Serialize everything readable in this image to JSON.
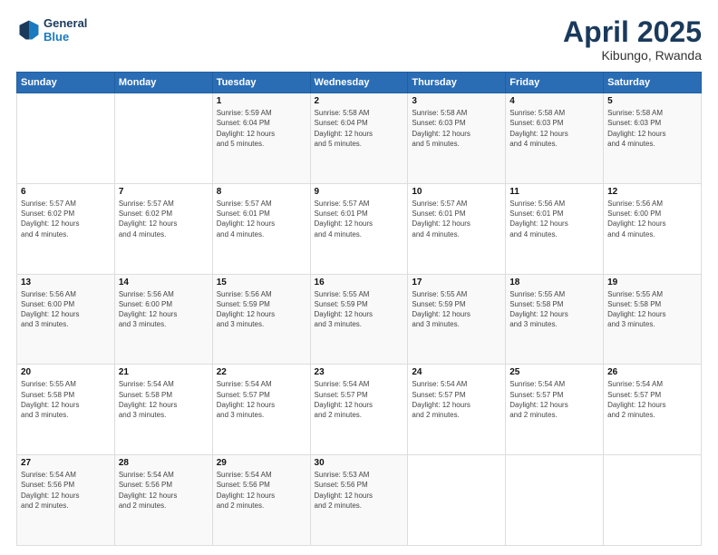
{
  "header": {
    "logo_line1": "General",
    "logo_line2": "Blue",
    "title": "April 2025",
    "location": "Kibungo, Rwanda"
  },
  "days_of_week": [
    "Sunday",
    "Monday",
    "Tuesday",
    "Wednesday",
    "Thursday",
    "Friday",
    "Saturday"
  ],
  "weeks": [
    [
      {
        "day": "",
        "info": ""
      },
      {
        "day": "",
        "info": ""
      },
      {
        "day": "1",
        "info": "Sunrise: 5:59 AM\nSunset: 6:04 PM\nDaylight: 12 hours\nand 5 minutes."
      },
      {
        "day": "2",
        "info": "Sunrise: 5:58 AM\nSunset: 6:04 PM\nDaylight: 12 hours\nand 5 minutes."
      },
      {
        "day": "3",
        "info": "Sunrise: 5:58 AM\nSunset: 6:03 PM\nDaylight: 12 hours\nand 5 minutes."
      },
      {
        "day": "4",
        "info": "Sunrise: 5:58 AM\nSunset: 6:03 PM\nDaylight: 12 hours\nand 4 minutes."
      },
      {
        "day": "5",
        "info": "Sunrise: 5:58 AM\nSunset: 6:03 PM\nDaylight: 12 hours\nand 4 minutes."
      }
    ],
    [
      {
        "day": "6",
        "info": "Sunrise: 5:57 AM\nSunset: 6:02 PM\nDaylight: 12 hours\nand 4 minutes."
      },
      {
        "day": "7",
        "info": "Sunrise: 5:57 AM\nSunset: 6:02 PM\nDaylight: 12 hours\nand 4 minutes."
      },
      {
        "day": "8",
        "info": "Sunrise: 5:57 AM\nSunset: 6:01 PM\nDaylight: 12 hours\nand 4 minutes."
      },
      {
        "day": "9",
        "info": "Sunrise: 5:57 AM\nSunset: 6:01 PM\nDaylight: 12 hours\nand 4 minutes."
      },
      {
        "day": "10",
        "info": "Sunrise: 5:57 AM\nSunset: 6:01 PM\nDaylight: 12 hours\nand 4 minutes."
      },
      {
        "day": "11",
        "info": "Sunrise: 5:56 AM\nSunset: 6:01 PM\nDaylight: 12 hours\nand 4 minutes."
      },
      {
        "day": "12",
        "info": "Sunrise: 5:56 AM\nSunset: 6:00 PM\nDaylight: 12 hours\nand 4 minutes."
      }
    ],
    [
      {
        "day": "13",
        "info": "Sunrise: 5:56 AM\nSunset: 6:00 PM\nDaylight: 12 hours\nand 3 minutes."
      },
      {
        "day": "14",
        "info": "Sunrise: 5:56 AM\nSunset: 6:00 PM\nDaylight: 12 hours\nand 3 minutes."
      },
      {
        "day": "15",
        "info": "Sunrise: 5:56 AM\nSunset: 5:59 PM\nDaylight: 12 hours\nand 3 minutes."
      },
      {
        "day": "16",
        "info": "Sunrise: 5:55 AM\nSunset: 5:59 PM\nDaylight: 12 hours\nand 3 minutes."
      },
      {
        "day": "17",
        "info": "Sunrise: 5:55 AM\nSunset: 5:59 PM\nDaylight: 12 hours\nand 3 minutes."
      },
      {
        "day": "18",
        "info": "Sunrise: 5:55 AM\nSunset: 5:58 PM\nDaylight: 12 hours\nand 3 minutes."
      },
      {
        "day": "19",
        "info": "Sunrise: 5:55 AM\nSunset: 5:58 PM\nDaylight: 12 hours\nand 3 minutes."
      }
    ],
    [
      {
        "day": "20",
        "info": "Sunrise: 5:55 AM\nSunset: 5:58 PM\nDaylight: 12 hours\nand 3 minutes."
      },
      {
        "day": "21",
        "info": "Sunrise: 5:54 AM\nSunset: 5:58 PM\nDaylight: 12 hours\nand 3 minutes."
      },
      {
        "day": "22",
        "info": "Sunrise: 5:54 AM\nSunset: 5:57 PM\nDaylight: 12 hours\nand 3 minutes."
      },
      {
        "day": "23",
        "info": "Sunrise: 5:54 AM\nSunset: 5:57 PM\nDaylight: 12 hours\nand 2 minutes."
      },
      {
        "day": "24",
        "info": "Sunrise: 5:54 AM\nSunset: 5:57 PM\nDaylight: 12 hours\nand 2 minutes."
      },
      {
        "day": "25",
        "info": "Sunrise: 5:54 AM\nSunset: 5:57 PM\nDaylight: 12 hours\nand 2 minutes."
      },
      {
        "day": "26",
        "info": "Sunrise: 5:54 AM\nSunset: 5:57 PM\nDaylight: 12 hours\nand 2 minutes."
      }
    ],
    [
      {
        "day": "27",
        "info": "Sunrise: 5:54 AM\nSunset: 5:56 PM\nDaylight: 12 hours\nand 2 minutes."
      },
      {
        "day": "28",
        "info": "Sunrise: 5:54 AM\nSunset: 5:56 PM\nDaylight: 12 hours\nand 2 minutes."
      },
      {
        "day": "29",
        "info": "Sunrise: 5:54 AM\nSunset: 5:56 PM\nDaylight: 12 hours\nand 2 minutes."
      },
      {
        "day": "30",
        "info": "Sunrise: 5:53 AM\nSunset: 5:56 PM\nDaylight: 12 hours\nand 2 minutes."
      },
      {
        "day": "",
        "info": ""
      },
      {
        "day": "",
        "info": ""
      },
      {
        "day": "",
        "info": ""
      }
    ]
  ]
}
